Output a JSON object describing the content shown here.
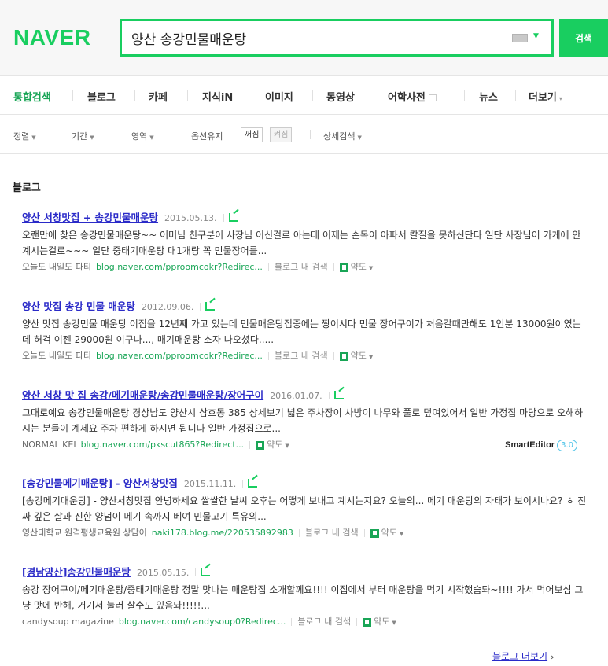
{
  "header": {
    "logo": "NAVER",
    "search_value": "양산 송강민물매운탕",
    "search_button": "검색"
  },
  "tabs": [
    {
      "label": "통합검색",
      "active": true
    },
    {
      "label": "블로그"
    },
    {
      "label": "카페"
    },
    {
      "label": "지식iN"
    },
    {
      "label": "이미지"
    },
    {
      "label": "동영상"
    },
    {
      "label": "어학사전"
    },
    {
      "label": "뉴스"
    },
    {
      "label": "더보기"
    }
  ],
  "options": {
    "sort": "정렬",
    "period": "기간",
    "area": "영역",
    "keep_options": "옵션유지",
    "toggle_off": "꺼짐",
    "toggle_on": "켜짐",
    "detail_search": "상세검색"
  },
  "section_title": "블로그",
  "results": [
    {
      "title": "양산 서창맛집 + 송강민물매운탕",
      "date": "2015.05.13.",
      "desc": "오랜만에 찾은 송강민물매운탕~~ 어머님 친구분이 사장님 이신걸로 아는데 이제는 손목이 아파서 칼질을 못하신단다 일단 사장님이 가게에 안계시는걸로~~~ 일단 중태기매운탕 대1개랑 꼭 민물장어를...",
      "author": "오늘도 내일도 파티",
      "url": "blog.naver.com/pproomcokr?Redirec...",
      "blog_search": "블로그 내 검색",
      "map": "약도"
    },
    {
      "title": "양산 맛집 송강 민물 매운탕",
      "date": "2012.09.06.",
      "desc": "양산 맛집 송강민물 매운탕 이집을 12년째 가고 있는데 민물매운탕집중에는 짱이시다 민물 장어구이가 처음갈때만해도 1인분 13000원이였는데 허걱 이젠 29000원 이구나..., 매기매운탕 소자 나오셨다.....",
      "author": "오늘도 내일도 파티",
      "url": "blog.naver.com/pproomcokr?Redirec...",
      "blog_search": "블로그 내 검색",
      "map": "약도"
    },
    {
      "title": "양산 서창 맛 집 송강/메기매운탕/송강민물매운탕/장어구이",
      "date": "2016.01.07.",
      "desc": "그대로예요 송강민물매운탕 경상남도 양산시 삼호동 385 상세보기 넓은 주차장이 사방이 나무와 풀로 덮여있어서 일반 가정집 마당으로 오해하시는 분들이 계세요 주차 편하게 하시면 됩니다 일반 가정집으로...",
      "author": "NORMAL KEI",
      "url": "blog.naver.com/pkscut865?Redirect...",
      "map": "약도",
      "smart_editor": "SmartEditor",
      "smart_editor_version": "3.0"
    },
    {
      "title": "[송강민물메기매운탕] - 양산서창맛집",
      "date": "2015.11.11.",
      "desc": "[송강메기매운탕] - 양산서창맛집 안녕하세요 쌀쌀한 날씨 오후는 어떻게 보내고 계시는지요? 오늘의... 메기 매운탕의 자태가 보이시나요? ㅎ 진짜 깊은 살과 진한 양념이 메기 속까지 베여 민물고기 특유의...",
      "author": "영산대학교 원격평생교육원 상담이",
      "url": "naki178.blog.me/220535892983",
      "blog_search": "블로그 내 검색",
      "map": "약도"
    },
    {
      "title": "[경남양산]송강민물매운탕",
      "date": "2015.05.15.",
      "desc": "송강 장어구이/메기매운탕/중태기매운탕 정말 맛나는 매운탕집 소개할께요!!!! 이집에서 부터 매운탕을 먹기 시작했습돠~!!!! 가서 먹어보심 그냥 맛에 반해, 거기서 눌러 살수도 있음돠!!!!!...",
      "author": "candysoup magazine",
      "url": "blog.naver.com/candysoup0?Redirec...",
      "blog_search": "블로그 내 검색",
      "map": "약도"
    }
  ],
  "more_link": "블로그 더보기",
  "colors": {
    "brand": "#19ce60",
    "link": "#2a2ac8",
    "url": "#19a556"
  }
}
